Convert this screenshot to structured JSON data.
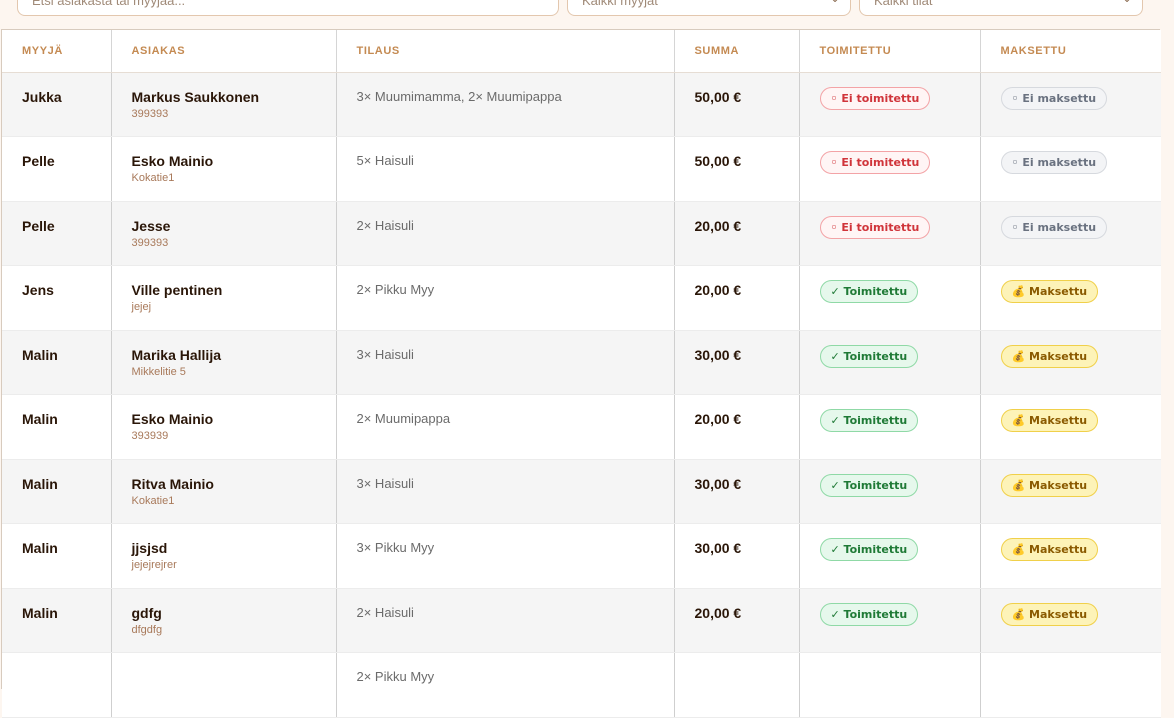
{
  "filters": {
    "search_placeholder": "Etsi asiakasta tai myyjää...",
    "seller_select": "Kaikki myyjät",
    "status_select": "Kaikki tilat"
  },
  "table": {
    "headers": [
      "MYYJÄ",
      "ASIAKAS",
      "TILAUS",
      "SUMMA",
      "TOIMITETTU",
      "MAKSETTU"
    ],
    "rows": [
      {
        "seller": "Jukka",
        "customer": "Markus Saukkonen",
        "customer_sub": "399393",
        "order": "3× Muumimamma, 2× Muumipappa",
        "sum": "50,00 €",
        "delivered": "◦ Ei toimitettu",
        "delivered_state": "no",
        "paid": "◦ Ei maksettu",
        "paid_state": "no"
      },
      {
        "seller": "Pelle",
        "customer": "Esko Mainio",
        "customer_sub": "Kokatie1",
        "order": "5× Haisuli",
        "sum": "50,00 €",
        "delivered": "◦ Ei toimitettu",
        "delivered_state": "no",
        "paid": "◦ Ei maksettu",
        "paid_state": "no"
      },
      {
        "seller": "Pelle",
        "customer": "Jesse",
        "customer_sub": "399393",
        "order": "2× Haisuli",
        "sum": "20,00 €",
        "delivered": "◦ Ei toimitettu",
        "delivered_state": "no",
        "paid": "◦ Ei maksettu",
        "paid_state": "no"
      },
      {
        "seller": "Jens",
        "customer": "Ville pentinen",
        "customer_sub": "jejej",
        "order": "2× Pikku Myy",
        "sum": "20,00 €",
        "delivered": "✓ Toimitettu",
        "delivered_state": "yes",
        "paid": "💰 Maksettu",
        "paid_state": "yes"
      },
      {
        "seller": "Malin",
        "customer": "Marika Hallija",
        "customer_sub": "Mikkelitie 5",
        "order": "3× Haisuli",
        "sum": "30,00 €",
        "delivered": "✓ Toimitettu",
        "delivered_state": "yes",
        "paid": "💰 Maksettu",
        "paid_state": "yes"
      },
      {
        "seller": "Malin",
        "customer": "Esko Mainio",
        "customer_sub": "393939",
        "order": "2× Muumipappa",
        "sum": "20,00 €",
        "delivered": "✓ Toimitettu",
        "delivered_state": "yes",
        "paid": "💰 Maksettu",
        "paid_state": "yes"
      },
      {
        "seller": "Malin",
        "customer": "Ritva Mainio",
        "customer_sub": "Kokatie1",
        "order": "3× Haisuli",
        "sum": "30,00 €",
        "delivered": "✓ Toimitettu",
        "delivered_state": "yes",
        "paid": "💰 Maksettu",
        "paid_state": "yes"
      },
      {
        "seller": "Malin",
        "customer": "jjsjsd",
        "customer_sub": "jejejrejrer",
        "order": "3× Pikku Myy",
        "sum": "30,00 €",
        "delivered": "✓ Toimitettu",
        "delivered_state": "yes",
        "paid": "💰 Maksettu",
        "paid_state": "yes"
      },
      {
        "seller": "Malin",
        "customer": "gdfg",
        "customer_sub": "dfgdfg",
        "order": "2× Haisuli",
        "sum": "20,00 €",
        "delivered": "✓ Toimitettu",
        "delivered_state": "yes",
        "paid": "💰 Maksettu",
        "paid_state": "yes"
      },
      {
        "seller": "",
        "customer": "",
        "customer_sub": "",
        "order": "2× Pikku Myy",
        "sum": "",
        "delivered": "",
        "delivered_state": "no",
        "paid": "",
        "paid_state": "no"
      }
    ]
  }
}
